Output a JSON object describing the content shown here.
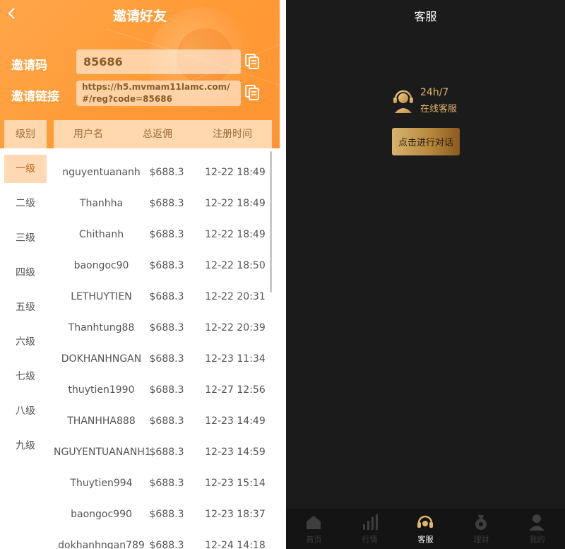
{
  "header": {
    "title": "邀请好友",
    "invite_code_label": "邀请码",
    "invite_code_value": "85686",
    "invite_link_label": "邀请链接",
    "invite_link_value": "https://h5.mvmam11lamc.com/#/reg?code=85686"
  },
  "table": {
    "headers": {
      "level": "级别",
      "username": "用户名",
      "rebate": "总返佣",
      "register_time": "注册时间"
    },
    "levels": [
      "一级",
      "二级",
      "三级",
      "四级",
      "五级",
      "六级",
      "七级",
      "八级",
      "九级"
    ],
    "active_level": "一级",
    "rows": [
      {
        "username": "nguyentuananh",
        "rebate": "$688.3",
        "time": "12-22 18:49"
      },
      {
        "username": "Thanhha",
        "rebate": "$688.3",
        "time": "12-22 18:49"
      },
      {
        "username": "Chithanh",
        "rebate": "$688.3",
        "time": "12-22 18:49"
      },
      {
        "username": "baongoc90",
        "rebate": "$688.3",
        "time": "12-22 18:50"
      },
      {
        "username": "LETHUYTIEN",
        "rebate": "$688.3",
        "time": "12-22 20:31"
      },
      {
        "username": "Thanhtung88",
        "rebate": "$688.3",
        "time": "12-22 20:39"
      },
      {
        "username": "DOKHANHNGAN",
        "rebate": "$688.3",
        "time": "12-23 11:34"
      },
      {
        "username": "thuytien1990",
        "rebate": "$688.3",
        "time": "12-27 12:56"
      },
      {
        "username": "THANHHA888",
        "rebate": "$688.3",
        "time": "12-23 14:49"
      },
      {
        "username": "NGUYENTUANANH1",
        "rebate": "$688.3",
        "time": "12-23 14:59"
      },
      {
        "username": "Thuytien994",
        "rebate": "$688.3",
        "time": "12-23 15:14"
      },
      {
        "username": "baongoc990",
        "rebate": "$688.3",
        "time": "12-23 18:37"
      },
      {
        "username": "dokhanhngan789",
        "rebate": "$688.3",
        "time": "12-24 14:18"
      }
    ]
  },
  "service": {
    "title": "客服",
    "hours": "24h/7",
    "online_label": "在线客服",
    "chat_button": "点击进行对话"
  },
  "tabbar": {
    "items": [
      {
        "label": "首页",
        "icon": "home-icon"
      },
      {
        "label": "行情",
        "icon": "chart-bars-icon"
      },
      {
        "label": "客服",
        "icon": "headset-icon"
      },
      {
        "label": "理财",
        "icon": "money-bag-icon"
      },
      {
        "label": "我的",
        "icon": "user-icon"
      }
    ],
    "active": "客服"
  },
  "colors": {
    "accent_orange": "#ff9a35",
    "gold": "#e0b66a",
    "dark_bg": "#1b1b1b"
  }
}
